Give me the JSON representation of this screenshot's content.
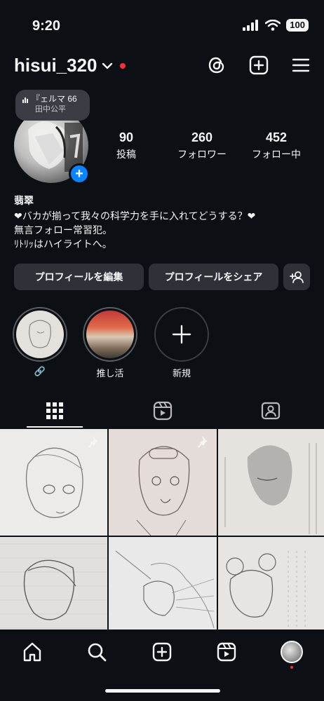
{
  "status": {
    "time": "9:20",
    "battery": "100"
  },
  "header": {
    "username": "hisui_320",
    "icons": [
      "threads-icon",
      "create-post-icon",
      "menu-icon"
    ]
  },
  "profile": {
    "music": {
      "title": "『ェルマ 66",
      "artist": "田中公平"
    },
    "stats": [
      {
        "value": "90",
        "label": "投稿"
      },
      {
        "value": "260",
        "label": "フォロワー"
      },
      {
        "value": "452",
        "label": "フォロー中"
      }
    ],
    "display_name": "翡翠",
    "bio": [
      "❤バカが揃って我々の科学力を手に入れてどうする？❤",
      "無言フォロー常習犯。",
      "ﾘﾄﾘｯはハイライトへ。"
    ]
  },
  "buttons": {
    "edit": "プロフィールを編集",
    "share": "プロフィールをシェア"
  },
  "highlights": [
    {
      "label": "🔗"
    },
    {
      "label": "推し活"
    },
    {
      "label": "新規"
    }
  ],
  "tabs": [
    "grid-tab",
    "reels-tab",
    "tagged-tab"
  ],
  "posts": [
    {
      "pinned": true,
      "bg": "#ecebea"
    },
    {
      "pinned": true,
      "bg": "#e3dcd8"
    },
    {
      "pinned": false,
      "bg": "#e6e3df"
    },
    {
      "pinned": false,
      "bg": "#e2e0de"
    },
    {
      "pinned": false,
      "bg": "#e9e9e9"
    },
    {
      "pinned": false,
      "bg": "#e7e4e1"
    }
  ],
  "colors": {
    "background": "#0c0f14",
    "button": "#2e3138",
    "accent": "#0a84ff",
    "notification": "#ff2d3a"
  }
}
